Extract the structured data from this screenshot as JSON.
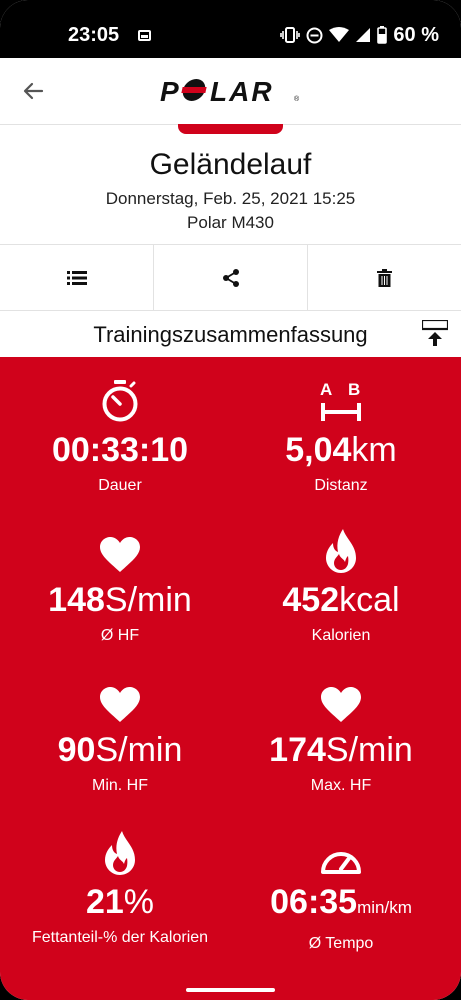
{
  "status_bar": {
    "time": "23:05",
    "battery_text": "60 %"
  },
  "app": {
    "brand": "POLAR"
  },
  "session": {
    "title": "Geländelauf",
    "date": "Donnerstag, Feb. 25, 2021 15:25",
    "device": "Polar M430"
  },
  "section": {
    "title": "Trainingszusammenfassung"
  },
  "stats": {
    "duration": {
      "value": "00:33:10",
      "unit": "",
      "label": "Dauer"
    },
    "distance": {
      "value": "5,04",
      "unit": "km",
      "label": "Distanz"
    },
    "avg_hr": {
      "value": "148",
      "unit": "S/min",
      "label": "Ø HF"
    },
    "calories": {
      "value": "452",
      "unit": "kcal",
      "label": "Kalorien"
    },
    "min_hr": {
      "value": "90",
      "unit": "S/min",
      "label": "Min. HF"
    },
    "max_hr": {
      "value": "174",
      "unit": "S/min",
      "label": "Max. HF"
    },
    "fat": {
      "value": "21",
      "unit": "%",
      "label": "Fettanteil-% der Kalorien"
    },
    "pace": {
      "value": "06:35",
      "unit": "min/km",
      "label": "Ø Tempo"
    }
  },
  "colors": {
    "accent": "#d0021b",
    "status_bar": "#000000"
  },
  "icons": {
    "back": "arrow-back-icon",
    "list": "list-icon",
    "share": "share-icon",
    "delete": "trash-icon",
    "pin": "pin-to-top-icon",
    "duration": "stopwatch-icon",
    "distance": "distance-ab-icon",
    "heart": "heart-icon",
    "calories": "flame-icon",
    "pace": "speedometer-icon"
  }
}
